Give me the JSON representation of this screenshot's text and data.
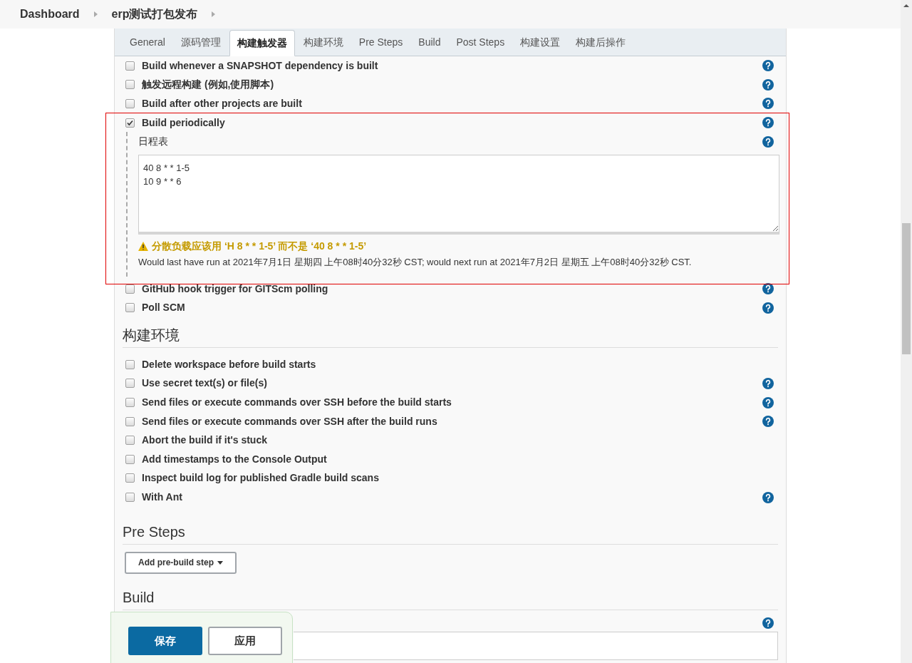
{
  "breadcrumbs": [
    "Dashboard",
    "erp测试打包发布"
  ],
  "tabs": [
    {
      "label": "General",
      "selected": false
    },
    {
      "label": "源码管理",
      "selected": false
    },
    {
      "label": "构建触发器",
      "selected": true
    },
    {
      "label": "构建环境",
      "selected": false
    },
    {
      "label": "Pre Steps",
      "selected": false
    },
    {
      "label": "Build",
      "selected": false
    },
    {
      "label": "Post Steps",
      "selected": false
    },
    {
      "label": "构建设置",
      "selected": false
    },
    {
      "label": "构建后操作",
      "selected": false
    }
  ],
  "triggers": [
    {
      "label": "Build whenever a SNAPSHOT dependency is built",
      "checked": false,
      "help": true
    },
    {
      "label": "触发远程构建 (例如,使用脚本)",
      "checked": false,
      "help": true
    },
    {
      "label": "Build after other projects are built",
      "checked": false,
      "help": true
    },
    {
      "label": "Build periodically",
      "checked": true,
      "help": true,
      "schedule": {
        "label": "日程表",
        "value": "40 8 * * 1-5\n10 9 * * 6",
        "warning": "分散负载应该用 ‘H 8 * * 1-5’ 而不是 ‘40 8 * * 1-5’",
        "info": "Would last have run at 2021年7月1日 星期四 上午08时40分32秒 CST; would next run at 2021年7月2日 星期五 上午08时40分32秒 CST."
      }
    },
    {
      "label": "GitHub hook trigger for GITScm polling",
      "checked": false,
      "help": true
    },
    {
      "label": "Poll SCM",
      "checked": false,
      "help": true
    }
  ],
  "build_environment": {
    "title": "构建环境",
    "options": [
      {
        "label": "Delete workspace before build starts",
        "checked": false,
        "help": false
      },
      {
        "label": "Use secret text(s) or file(s)",
        "checked": false,
        "help": true
      },
      {
        "label": "Send files or execute commands over SSH before the build starts",
        "checked": false,
        "help": true
      },
      {
        "label": "Send files or execute commands over SSH after the build runs",
        "checked": false,
        "help": true
      },
      {
        "label": "Abort the build if it's stuck",
        "checked": false,
        "help": false
      },
      {
        "label": "Add timestamps to the Console Output",
        "checked": false,
        "help": false
      },
      {
        "label": "Inspect build log for published Gradle build scans",
        "checked": false,
        "help": false
      },
      {
        "label": "With Ant",
        "checked": false,
        "help": true
      }
    ]
  },
  "pre_steps": {
    "title": "Pre Steps",
    "button": "Add pre-build step"
  },
  "build": {
    "title": "Build"
  },
  "save_bar": {
    "buttons": [
      {
        "label": "保存",
        "kind": "primary"
      },
      {
        "label": "应用",
        "kind": "secondary"
      }
    ]
  }
}
